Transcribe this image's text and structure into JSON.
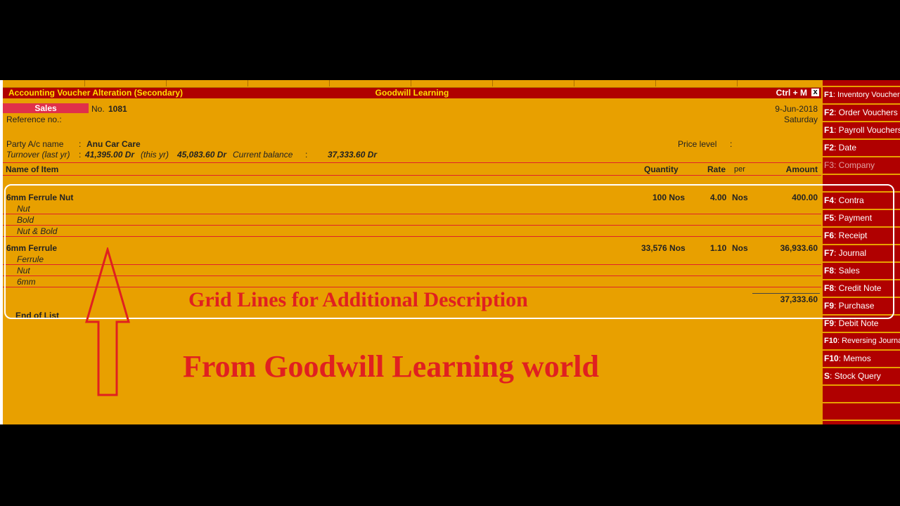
{
  "title_bar": {
    "left": "Accounting Voucher  Alteration  (Secondary)",
    "center": "Goodwill Learning",
    "right": "Ctrl + M",
    "close": "x"
  },
  "voucher": {
    "type": "Sales",
    "no_label": "No.",
    "no_value": "1081",
    "reference_label": "Reference no.:",
    "date": "9-Jun-2018",
    "day": "Saturday"
  },
  "party": {
    "label": "Party A/c name",
    "colon": ":",
    "value": "Anu Car Care",
    "price_level_label": "Price level",
    "price_level_colon": ":"
  },
  "turnover": {
    "label": "Turnover (last yr)",
    "colon": ":",
    "last_yr": "41,395.00 Dr",
    "this_yr_label": "(this yr)",
    "this_yr": "45,083.60 Dr",
    "current_label": "Current balance",
    "current_colon": ":",
    "current": "37,333.60 Dr"
  },
  "columns": {
    "name": "Name of Item",
    "quantity": "Quantity",
    "rate": "Rate",
    "per": "per",
    "amount": "Amount"
  },
  "items": [
    {
      "name": "6mm Ferrule Nut",
      "quantity": "100 Nos",
      "rate": "4.00",
      "per": "Nos",
      "amount": "400.00",
      "descriptions": [
        "Nut",
        "Bold",
        "Nut & Bold"
      ]
    },
    {
      "name": "6mm Ferrule",
      "quantity": "33,576 Nos",
      "rate": "1.10",
      "per": "Nos",
      "amount": "36,933.60",
      "descriptions": [
        "Ferrule",
        "Nut",
        "6mm"
      ]
    }
  ],
  "total": "37,333.60",
  "end_of_list": "End of List",
  "right_panel": [
    {
      "key": "F1",
      "label": ": Inventory Vouchers",
      "small": true
    },
    {
      "key": "F2",
      "label": ": Order Vouchers",
      "small": false
    },
    {
      "key": "F1",
      "label": ": Payroll Vouchers",
      "small": false
    },
    {
      "key": "F2",
      "label": ": Date",
      "small": false
    },
    {
      "key": "F3",
      "label": ": Company",
      "small": false,
      "dim": true
    },
    {
      "key": "F4",
      "label": ": Contra",
      "small": false
    },
    {
      "key": "F5",
      "label": ": Payment",
      "small": false
    },
    {
      "key": "F6",
      "label": ": Receipt",
      "small": false
    },
    {
      "key": "F7",
      "label": ": Journal",
      "small": false
    },
    {
      "key": "F8",
      "label": ": Sales",
      "small": false
    },
    {
      "key": "F8",
      "label": ": Credit Note",
      "small": false
    },
    {
      "key": "F9",
      "label": ": Purchase",
      "small": false
    },
    {
      "key": "F9",
      "label": ": Debit Note",
      "small": false
    },
    {
      "key": "F10",
      "label": ": Reversing Journal",
      "small": true
    },
    {
      "key": "F10",
      "label": ": Memos",
      "small": false
    },
    {
      "key": "S",
      "label": ": Stock Query",
      "small": false
    }
  ],
  "annotations": {
    "grid_lines": "Grid Lines for Additional Description",
    "source": "From Goodwill Learning world"
  },
  "colors": {
    "background": "#E8A000",
    "title_bar": "#B00000",
    "accent_red": "#E02020"
  }
}
